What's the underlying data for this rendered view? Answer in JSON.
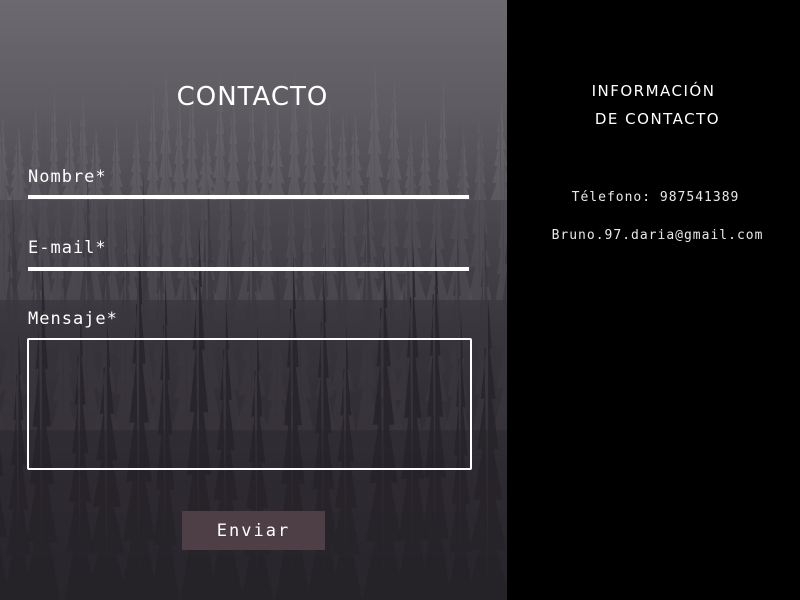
{
  "form": {
    "title": "CONTACTO",
    "name_label": "Nombre*",
    "email_label": "E-mail*",
    "message_label": "Mensaje*",
    "name_value": "",
    "email_value": "",
    "message_value": "",
    "submit_label": "Enviar"
  },
  "info": {
    "title_line1": "INFORMACIÓN",
    "title_line2": "DE CONTACTO",
    "phone": "Télefono: 987541389",
    "email": "Bruno.97.daria@gmail.com"
  },
  "colors": {
    "button_bg": "#4e3f46",
    "right_panel_bg": "#000000",
    "text": "#ffffff"
  }
}
